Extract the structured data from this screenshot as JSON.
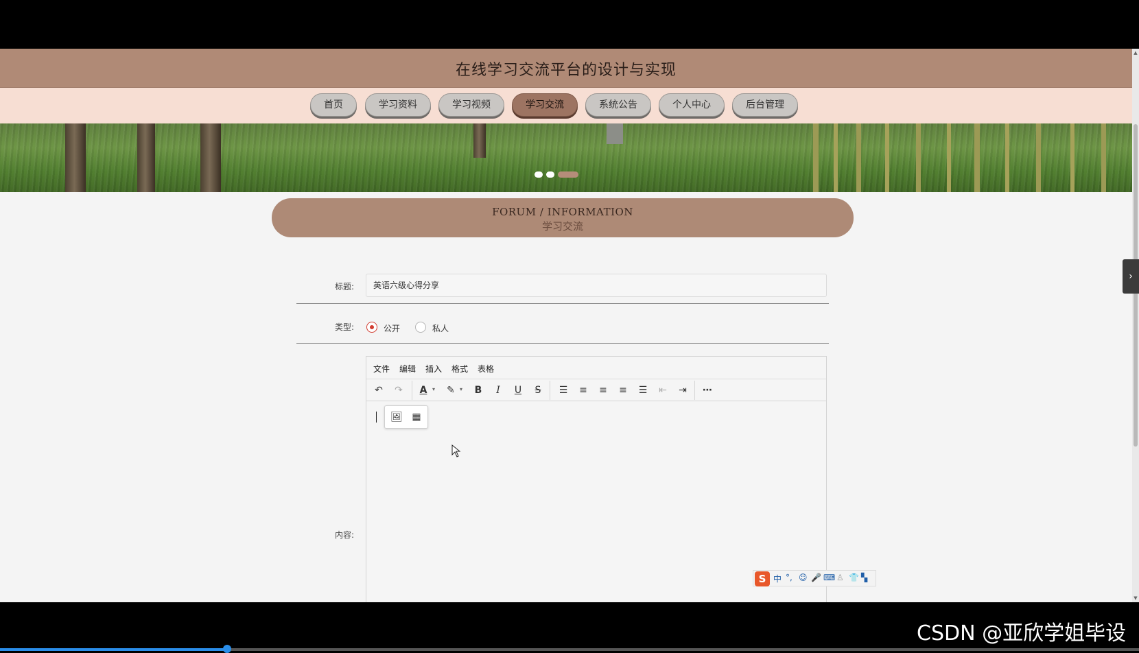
{
  "site": {
    "title": "在线学习交流平台的设计与实现"
  },
  "nav": {
    "items": [
      {
        "label": "首页"
      },
      {
        "label": "学习资料"
      },
      {
        "label": "学习视频"
      },
      {
        "label": "学习交流"
      },
      {
        "label": "系统公告"
      },
      {
        "label": "个人中心"
      },
      {
        "label": "后台管理"
      }
    ],
    "active": "学习交流"
  },
  "banner": {
    "slide_count": 3,
    "active_slide": 3
  },
  "section": {
    "title_en": "FORUM / INFORMATION",
    "title_cn": "学习交流"
  },
  "form": {
    "title_label": "标题:",
    "title_value": "英语六级心得分享",
    "type_label": "类型:",
    "type_options": [
      {
        "label": "公开",
        "checked": true
      },
      {
        "label": "私人",
        "checked": false
      }
    ],
    "content_label": "内容:"
  },
  "editor": {
    "menu": [
      "文件",
      "编辑",
      "插入",
      "格式",
      "表格"
    ],
    "toolbar_icons": [
      "undo-icon",
      "redo-icon",
      "font-color-icon",
      "highlight-icon",
      "bold-icon",
      "italic-icon",
      "underline-icon",
      "strikethrough-icon",
      "line-height-icon",
      "align-left-icon",
      "align-center-icon",
      "align-right-icon",
      "align-justify-icon",
      "outdent-icon",
      "indent-icon",
      "more-icon"
    ],
    "quick_insert_icons": [
      "image-icon",
      "table-icon"
    ]
  },
  "ime": {
    "logo": "S",
    "mode": "中"
  },
  "side_tab": {
    "icon": "chevron-right-icon",
    "glyph": "›"
  },
  "watermark": "CSDN @亚欣学姐毕设",
  "colors": {
    "header_bg": "#b08a76",
    "nav_bg": "#f7ded3",
    "accent_radio": "#d23c30",
    "active_nav": "#9d7462"
  }
}
